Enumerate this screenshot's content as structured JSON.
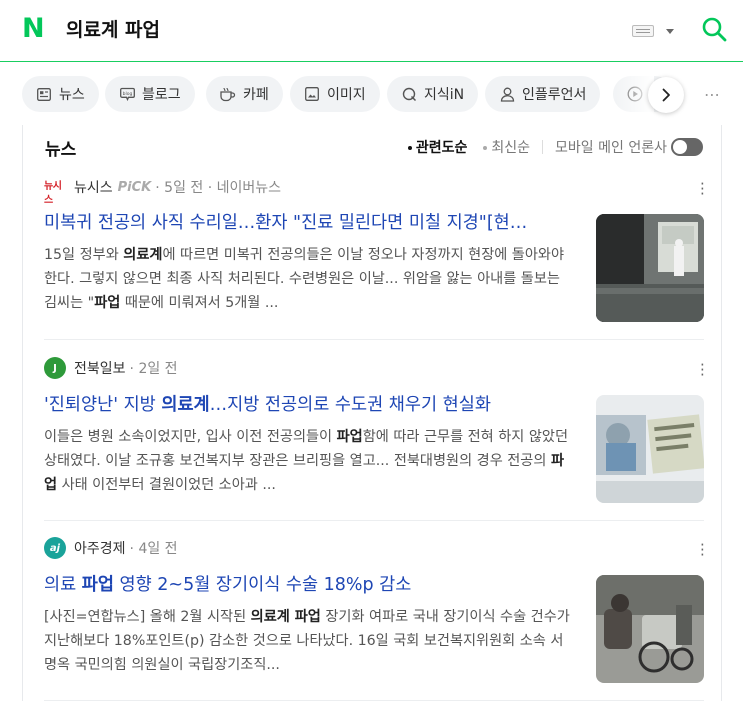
{
  "search": {
    "query": "의료계 파업"
  },
  "tabs": [
    {
      "label": "뉴스",
      "icon": "news-icon"
    },
    {
      "label": "블로그",
      "icon": "blog-icon"
    },
    {
      "label": "카페",
      "icon": "cafe-icon"
    },
    {
      "label": "이미지",
      "icon": "image-icon"
    },
    {
      "label": "지식iN",
      "icon": "kin-icon"
    },
    {
      "label": "인플루언서",
      "icon": "influencer-icon"
    },
    {
      "label": "",
      "icon": "video-icon"
    }
  ],
  "news_section": {
    "title": "뉴스",
    "sort_relevance": "관련도순",
    "sort_latest": "최신순",
    "mobile_main": "모바일 메인 언론사"
  },
  "articles": [
    {
      "press": "뉴시스",
      "pick": "PiCK",
      "time": "5일 전",
      "via": "네이버뉴스",
      "title_parts": [
        "미복귀 전공의 사직 수리일…환자 \"진료 밀린다면 미칠 지경\"[현…"
      ],
      "desc_parts": [
        "15일 정부와 ",
        "의료계",
        "에 따르면 미복귀 전공의들은 이날 정오나 자정까지 현장에 돌아와야 한다. 그렇지 않으면 최종 사직 처리된다. 수련병원은 이날... 위암을 앓는 아내를 돌보는 김씨는 \"",
        "파업",
        " 때문에 미뤄져서 5개월 ..."
      ]
    },
    {
      "press": "전북일보",
      "time": "2일 전",
      "title_parts": [
        "'진퇴양난' 지방 ",
        "의료계",
        "…지방 전공의로 수도권 채우기 현실화"
      ],
      "desc_parts": [
        "이들은 병원 소속이었지만, 입사 이전 전공의들이 ",
        "파업",
        "함에 따라 근무를 전혀 하지 않았던 상태였다. 이날 조규홍 보건복지부 장관은 브리핑을 열고... 전북대병원의 경우 전공의 ",
        "파업",
        " 사태 이전부터 결원이었던 소아과 ..."
      ]
    },
    {
      "press": "아주경제",
      "time": "4일 전",
      "title_parts": [
        "의료 ",
        "파업",
        " 영향 2~5월 장기이식 수술 18%p 감소"
      ],
      "desc_parts": [
        "[사진=연합뉴스] 올해 2월 시작된 ",
        "의료계 파업",
        " 장기화 여파로 국내 장기이식 수술 건수가 지난해보다 18%포인트(p) 감소한 것으로 나타났다. 16일 국회 보건복지위원회 소속 서명옥 국민의힘 의원실이 국립장기조직..."
      ]
    }
  ],
  "colors": {
    "brand": "#03c75a",
    "link": "#1e46b4"
  }
}
